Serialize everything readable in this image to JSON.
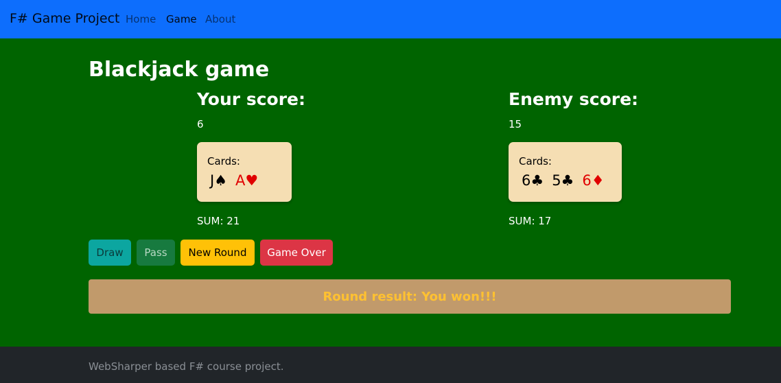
{
  "navbar": {
    "brand": "F# Game Project",
    "links": [
      {
        "label": "Home",
        "active": false
      },
      {
        "label": "Game",
        "active": true
      },
      {
        "label": "About",
        "active": false
      }
    ]
  },
  "main": {
    "title": "Blackjack game",
    "player": {
      "heading": "Your score:",
      "score": "6",
      "cards_label": "Cards:",
      "cards": [
        {
          "rank": "J",
          "suit": "♠",
          "text": "J♠",
          "color": "black"
        },
        {
          "rank": "A",
          "suit": "♥",
          "text": "A♥",
          "color": "red"
        }
      ],
      "sum": "SUM: 21"
    },
    "enemy": {
      "heading": "Enemy score:",
      "score": "15",
      "cards_label": "Cards:",
      "cards": [
        {
          "rank": "6",
          "suit": "♣",
          "text": "6♣",
          "color": "black"
        },
        {
          "rank": "5",
          "suit": "♣",
          "text": "5♣",
          "color": "black"
        },
        {
          "rank": "6",
          "suit": "♦",
          "text": "6♦",
          "color": "red"
        }
      ],
      "sum": "SUM: 17"
    },
    "buttons": {
      "draw": "Draw",
      "pass": "Pass",
      "new_round": "New Round",
      "game_over": "Game Over"
    },
    "result": "Round result: You won!!!"
  },
  "footer": {
    "text": "WebSharper based F# course project."
  },
  "colors": {
    "navbar": "#0d6efd",
    "table": "#006400",
    "card_bg": "#f5deb3",
    "red_suit": "#e00000",
    "result_bg": "#c19a6b",
    "result_text": "#ffc131",
    "footer": "#212529"
  }
}
